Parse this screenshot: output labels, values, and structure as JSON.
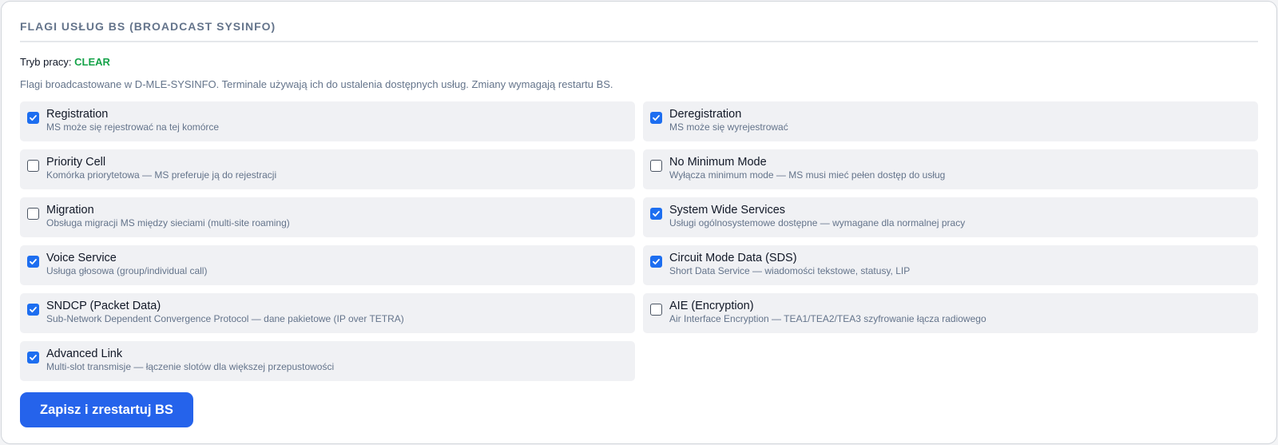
{
  "header": {
    "title": "FLAGI USŁUG BS (BROADCAST SYSINFO)"
  },
  "mode": {
    "label": "Tryb pracy:",
    "value": "CLEAR",
    "value_color": "#16a34a"
  },
  "description": "Flagi broadcastowane w D-MLE-SYSINFO. Terminale używają ich do ustalenia dostępnych usług. Zmiany wymagają restartu BS.",
  "flags": [
    {
      "name": "Registration",
      "sub": "MS może się rejestrować na tej komórce",
      "checked": true
    },
    {
      "name": "Deregistration",
      "sub": "MS może się wyrejestrować",
      "checked": true
    },
    {
      "name": "Priority Cell",
      "sub": "Komórka priorytetowa — MS preferuje ją do rejestracji",
      "checked": false
    },
    {
      "name": "No Minimum Mode",
      "sub": "Wyłącza minimum mode — MS musi mieć pełen dostęp do usług",
      "checked": false
    },
    {
      "name": "Migration",
      "sub": "Obsługa migracji MS między sieciami (multi-site roaming)",
      "checked": false
    },
    {
      "name": "System Wide Services",
      "sub": "Usługi ogólnosystemowe dostępne — wymagane dla normalnej pracy",
      "checked": true
    },
    {
      "name": "Voice Service",
      "sub": "Usługa głosowa (group/individual call)",
      "checked": true
    },
    {
      "name": "Circuit Mode Data (SDS)",
      "sub": "Short Data Service — wiadomości tekstowe, statusy, LIP",
      "checked": true
    },
    {
      "name": "SNDCP (Packet Data)",
      "sub": "Sub-Network Dependent Convergence Protocol — dane pakietowe (IP over TETRA)",
      "checked": true
    },
    {
      "name": "AIE (Encryption)",
      "sub": "Air Interface Encryption — TEA1/TEA2/TEA3 szyfrowanie łącza radiowego",
      "checked": false
    },
    {
      "name": "Advanced Link",
      "sub": "Multi-slot transmisje — łączenie slotów dla większej przepustowości",
      "checked": true
    }
  ],
  "save_button": {
    "label": "Zapisz i zrestartuj BS"
  },
  "colors": {
    "accent": "#2563eb",
    "checkbox": "#1d6ef0",
    "card_bg": "#f0f1f4"
  }
}
